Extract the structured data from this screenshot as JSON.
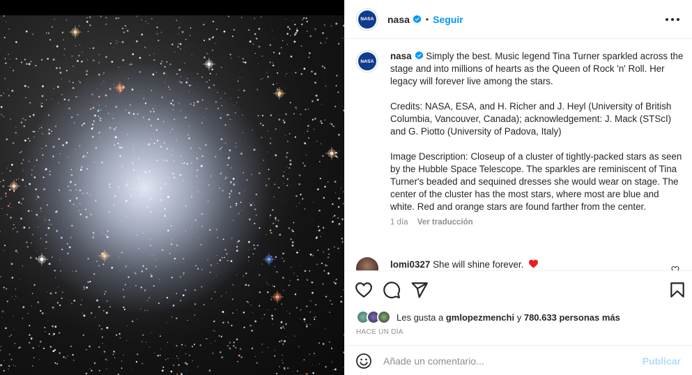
{
  "post": {
    "media_alt": "Closeup of a cluster of tightly-packed stars",
    "header": {
      "username": "nasa",
      "avatar_text": "NASA",
      "separator": "•",
      "follow_label": "Seguir",
      "more_icon": "more-options-icon"
    },
    "caption": {
      "username": "nasa",
      "paragraphs": [
        "Simply the best. Music legend Tina Turner sparkled across the stage and into millions of hearts as the Queen of Rock 'n' Roll. Her legacy will forever live among the stars.",
        "Credits: NASA, ESA, and H. Richer and J. Heyl (University of British Columbia, Vancouver, Canada); acknowledgement: J. Mack (STScI) and G. Piotto (University of Padova, Italy)",
        "Image Description: Closeup of a cluster of tightly-packed stars as seen by the Hubble Space Telescope. The sparkles are reminiscent of Tina Turner's beaded and sequined dresses she would wear on stage. The center of the cluster has the most stars, where most are blue and white. Red and orange stars are found farther from the center."
      ],
      "time": "1 día",
      "translate_label": "Ver traducción"
    },
    "comments": [
      {
        "username": "lomi0327",
        "text": "She will shine forever."
      }
    ],
    "likes": {
      "prefix": "Les gusta a",
      "liker": "gmlopezmenchi",
      "connector": "y",
      "others": "780.633 personas más"
    },
    "posted_ago": "HACE UN DÍA",
    "composer": {
      "placeholder": "Añade un comentario...",
      "publish_label": "Publicar"
    }
  },
  "colors": {
    "accent": "#0095f6",
    "publish_disabled": "#b3dbff",
    "muted": "#8e8e8e",
    "text": "#262626",
    "heart": "#ed1c24",
    "verified": "#0095f6"
  }
}
